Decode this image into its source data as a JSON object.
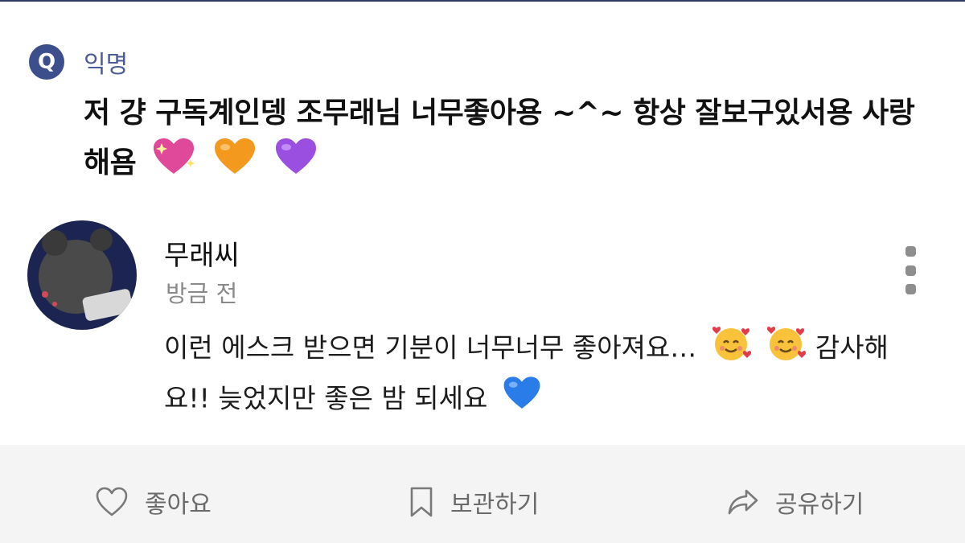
{
  "question": {
    "badge": "Q",
    "author": "익명",
    "text": "저 걍 구독계인뎅 조무래님 너무좋아용 ~^~ 항상 잘보구있서용 사랑해욤"
  },
  "answer": {
    "name": "무래씨",
    "time": "방금 전",
    "text_part1": "이런 에스크 받으면 기분이 너무너무 좋아져요…",
    "text_part2": "감사해요!! 늦었지만 좋은 밤 되세요"
  },
  "actions": {
    "like": "좋아요",
    "save": "보관하기",
    "share": "공유하기"
  },
  "icons": {
    "more": "more-vertical-icon",
    "like": "heart-outline-icon",
    "save": "bookmark-outline-icon",
    "share": "share-forward-icon"
  },
  "colors": {
    "accent": "#3c4e8c",
    "author_text": "#4a5c98",
    "muted_text": "#8a8a8a",
    "action_text": "#6a6a6a",
    "bottom_bar": "#f4f4f4"
  }
}
